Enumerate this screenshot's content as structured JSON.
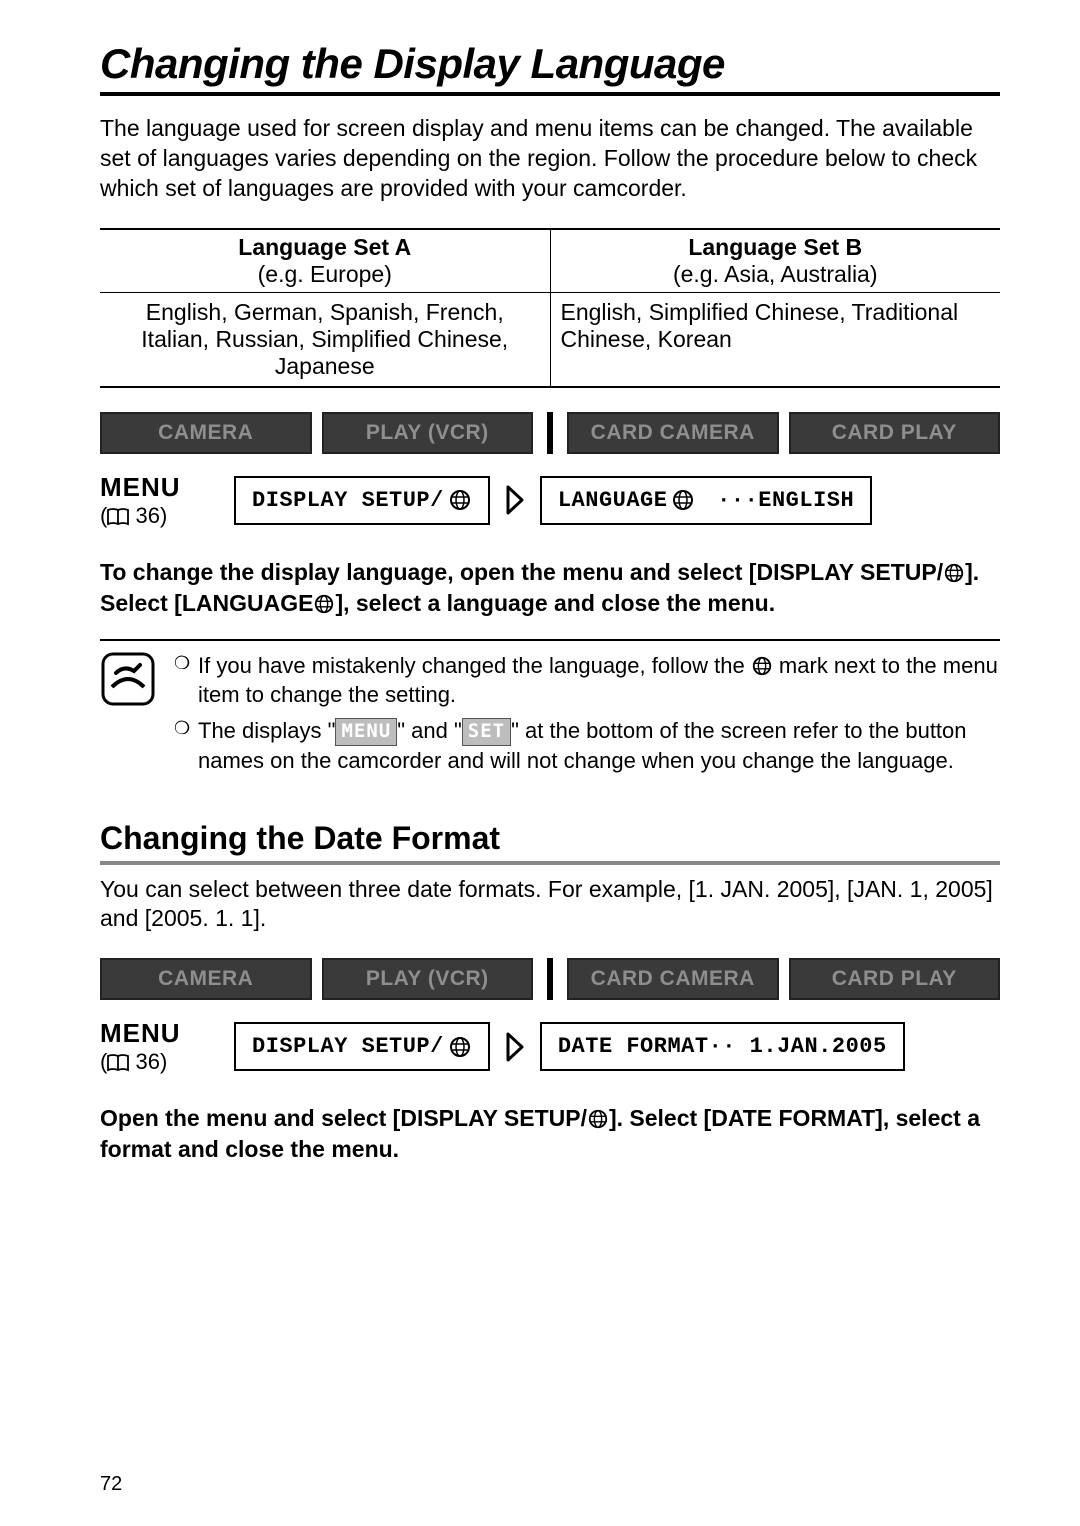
{
  "title": "Changing the Display Language",
  "intro": "The language used for screen display and menu items can be changed. The available set of languages varies depending on the region. Follow the procedure below to check which set of languages are provided with your camcorder.",
  "lang_table": {
    "headers": [
      {
        "title": "Language Set A",
        "sub": "(e.g. Europe)"
      },
      {
        "title": "Language Set B",
        "sub": "(e.g. Asia, Australia)"
      }
    ],
    "rows": [
      "English, German, Spanish, French, Italian, Russian, Simplified Chinese, Japanese",
      "English, Simplified Chinese, Traditional Chinese, Korean"
    ]
  },
  "modes": [
    "CAMERA",
    "PLAY (VCR)",
    "CARD CAMERA",
    "CARD PLAY"
  ],
  "menu": {
    "label": "MENU",
    "page": "36"
  },
  "path1": {
    "box1": "DISPLAY SETUP/",
    "box2_left": "LANGUAGE",
    "box2_right": "···ENGLISH"
  },
  "instruction1_a": "To change the display language, open the menu and select [DISPLAY SETUP/",
  "instruction1_b": "]. Select [LANGUAGE",
  "instruction1_c": "], select a language and close the menu.",
  "notes": {
    "n1a": "If you have mistakenly changed the language, follow the ",
    "n1b": " mark next to the menu item to change the setting.",
    "n2a": "The displays \"",
    "n2b": "\" and \"",
    "n2c": "\" at the bottom of the screen refer to the button names on the camcorder and will not change when you change the language.",
    "chip_menu": "MENU",
    "chip_set": "SET"
  },
  "subtitle": "Changing the Date Format",
  "date_intro": "You can select between three date formats. For example, [1. JAN. 2005], [JAN. 1, 2005] and [2005. 1. 1].",
  "path2": {
    "box1": "DISPLAY SETUP/",
    "box2": "DATE FORMAT·· 1.JAN.2005"
  },
  "instruction2_a": "Open the menu and select [DISPLAY SETUP/",
  "instruction2_b": "]. Select [DATE FORMAT], select a format and close the menu.",
  "page_number": "72"
}
